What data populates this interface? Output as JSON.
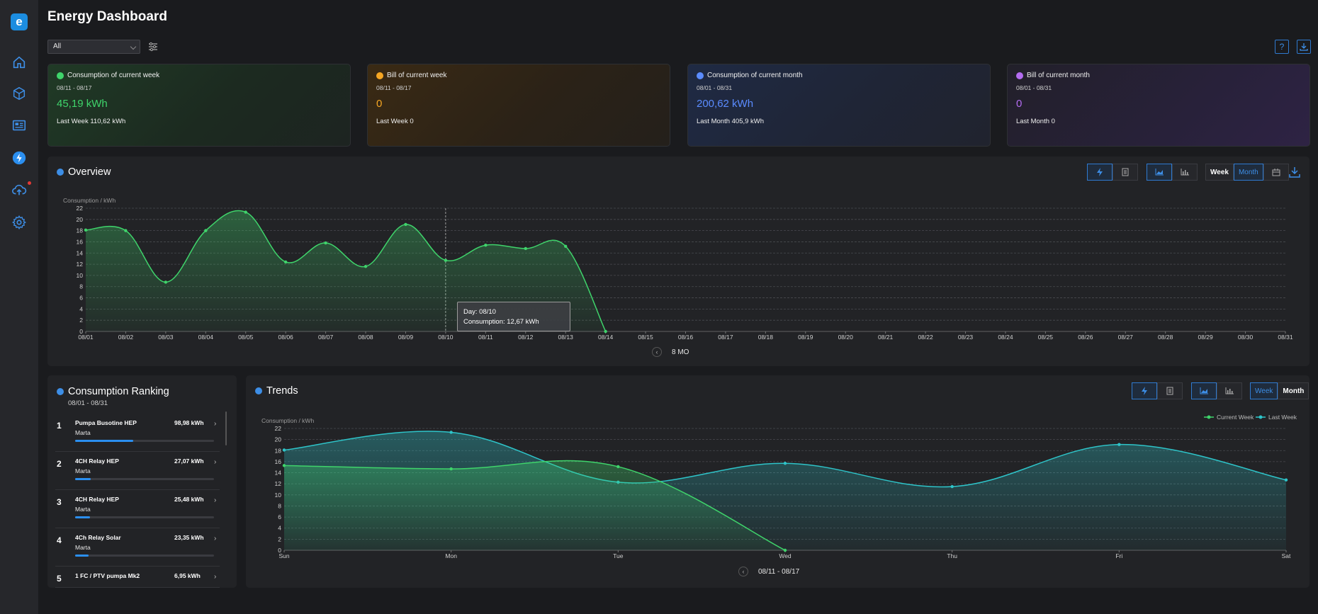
{
  "app": {
    "title": "Energy Dashboard",
    "logo_letter": "e"
  },
  "sidebar": {
    "items": [
      {
        "name": "home-icon"
      },
      {
        "name": "cube-icon"
      },
      {
        "name": "dashboard-icon"
      },
      {
        "name": "energy-icon",
        "active": true
      },
      {
        "name": "cloud-upload-icon",
        "badge": true
      },
      {
        "name": "settings-icon"
      }
    ]
  },
  "filter": {
    "selected": "All"
  },
  "cards": [
    {
      "title": "Consumption of current week",
      "range": "08/11 - 08/17",
      "value": "45,19 kWh",
      "last": "Last Week 110,62 kWh",
      "color": "#3fd46b"
    },
    {
      "title": "Bill of current week",
      "range": "08/11 - 08/17",
      "value": "0",
      "last": "Last Week 0",
      "color": "#f5a623"
    },
    {
      "title": "Consumption of current month",
      "range": "08/01 - 08/31",
      "value": "200,62 kWh",
      "last": "Last Month 405,9 kWh",
      "color": "#5b8cff"
    },
    {
      "title": "Bill of current month",
      "range": "08/01 - 08/31",
      "value": "0",
      "last": "Last Month 0",
      "color": "#b36cf0"
    }
  ],
  "overview": {
    "title": "Overview",
    "period_week": "Week",
    "period_month": "Month",
    "pager_label": "8 MO",
    "tooltip": {
      "day_label": "Day:  08/10",
      "value_label": "Consumption:  12,67 kWh"
    }
  },
  "ranking": {
    "title": "Consumption Ranking",
    "range": "08/01 - 08/31",
    "items": [
      {
        "rank": "1",
        "name": "Pumpa Busotine HEP",
        "value": "98,98 kWh",
        "owner": "Marta",
        "fraction": 0.42
      },
      {
        "rank": "2",
        "name": "4CH Relay HEP",
        "value": "27,07 kWh",
        "owner": "Marta",
        "fraction": 0.11
      },
      {
        "rank": "3",
        "name": "4CH Relay HEP",
        "value": "25,48 kWh",
        "owner": "Marta",
        "fraction": 0.105
      },
      {
        "rank": "4",
        "name": "4Ch Relay Solar",
        "value": "23,35 kWh",
        "owner": "Marta",
        "fraction": 0.095
      },
      {
        "rank": "5",
        "name": "1 FC / PTV pumpa Mk2",
        "value": "6,95 kWh",
        "owner": "Marta",
        "fraction": 0.03
      }
    ]
  },
  "trends": {
    "title": "Trends",
    "period_week": "Week",
    "period_month": "Month",
    "pager_label": "08/11 - 08/17"
  },
  "chart_data": [
    {
      "type": "area",
      "ylabel": "Consumption / kWh",
      "ylim": [
        0,
        22
      ],
      "yticks": [
        0,
        2,
        4,
        6,
        8,
        10,
        12,
        14,
        16,
        18,
        20,
        22
      ],
      "categories": [
        "08/01",
        "08/02",
        "08/03",
        "08/04",
        "08/05",
        "08/06",
        "08/07",
        "08/08",
        "08/09",
        "08/10",
        "08/11",
        "08/12",
        "08/13",
        "08/14",
        "08/15",
        "08/16",
        "08/17",
        "08/18",
        "08/19",
        "08/20",
        "08/21",
        "08/22",
        "08/23",
        "08/24",
        "08/25",
        "08/26",
        "08/27",
        "08/28",
        "08/29",
        "08/30",
        "08/31"
      ],
      "series": [
        {
          "values": [
            18.1,
            18.0,
            8.8,
            18.0,
            21.3,
            12.4,
            15.8,
            11.6,
            19.1,
            12.7,
            15.4,
            14.8,
            15.2,
            0
          ],
          "color": "#3fd46b"
        }
      ],
      "grid": true
    },
    {
      "type": "area",
      "ylabel": "Consumption / kWh",
      "ylim": [
        0,
        22
      ],
      "yticks": [
        0,
        2,
        4,
        6,
        8,
        10,
        12,
        14,
        16,
        18,
        20,
        22
      ],
      "categories": [
        "Sun",
        "Mon",
        "Tue",
        "Wed",
        "Thu",
        "Fri",
        "Sat"
      ],
      "legend": "top-right",
      "series": [
        {
          "name": "Current Week",
          "values": [
            15.3,
            14.7,
            15.1,
            0
          ],
          "color": "#3fd46b"
        },
        {
          "name": "Last Week",
          "values": [
            18.1,
            21.3,
            12.3,
            15.7,
            11.5,
            19.1,
            12.7
          ],
          "color": "#2ec4c9"
        }
      ],
      "grid": true
    }
  ]
}
